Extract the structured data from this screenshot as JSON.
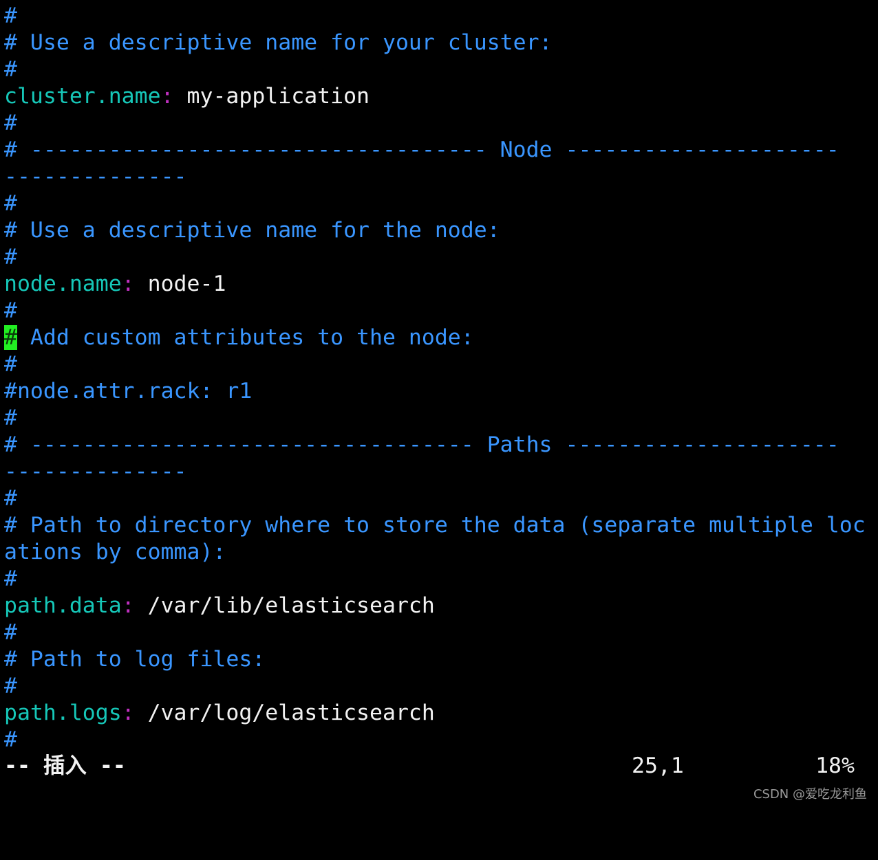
{
  "editor": {
    "lines": [
      {
        "comment": "#"
      },
      {
        "comment": "# Use a descriptive name for your cluster:"
      },
      {
        "comment": "#"
      },
      {
        "key": "cluster.name",
        "colon": ":",
        "value": " my-application"
      },
      {
        "comment": "#"
      },
      {
        "comment": "# ----------------------------------- Node ---------------------"
      },
      {
        "comment": "--------------"
      },
      {
        "comment": "#"
      },
      {
        "comment": "# Use a descriptive name for the node:"
      },
      {
        "comment": "#"
      },
      {
        "key": "node.name",
        "colon": ":",
        "value": " node-1"
      },
      {
        "comment": "#"
      },
      {
        "cursor": "#",
        "comment": " Add custom attributes to the node:"
      },
      {
        "comment": "#"
      },
      {
        "comment": "#node.attr.rack: r1"
      },
      {
        "comment": "#"
      },
      {
        "comment": "# ---------------------------------- Paths ---------------------"
      },
      {
        "comment": "--------------"
      },
      {
        "comment": "#"
      },
      {
        "comment": "# Path to directory where to store the data (separate multiple loc"
      },
      {
        "comment": "ations by comma):"
      },
      {
        "comment": "#"
      },
      {
        "key": "path.data",
        "colon": ":",
        "value": " /var/lib/elasticsearch"
      },
      {
        "comment": "#"
      },
      {
        "comment": "# Path to log files:"
      },
      {
        "comment": "#"
      },
      {
        "key": "path.logs",
        "colon": ":",
        "value": " /var/log/elasticsearch"
      },
      {
        "comment": "#"
      }
    ]
  },
  "statusbar": {
    "mode_prefix": "-- ",
    "mode_label": "插入",
    "mode_suffix": " --",
    "cursor_position": "25,1",
    "scroll_percent": "18%"
  },
  "watermark": "CSDN @爱吃龙利鱼",
  "colors": {
    "background": "#000000",
    "comment": "#3a96ff",
    "key": "#16c7b8",
    "colon": "#c030c0",
    "value": "#f2f2f2",
    "cursor": "#22ee22"
  }
}
